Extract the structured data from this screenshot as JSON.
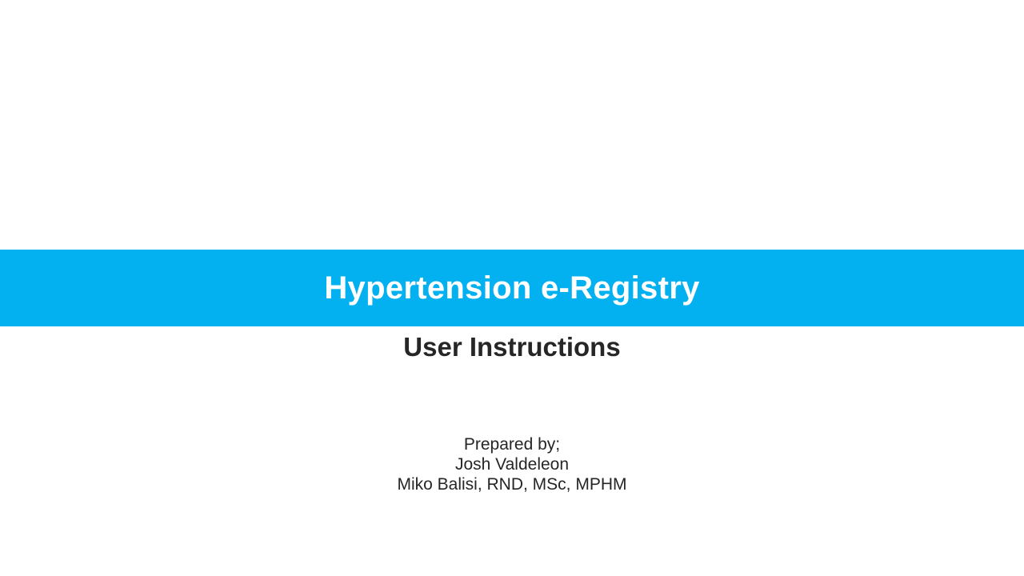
{
  "slide": {
    "title": "Hypertension e-Registry",
    "subtitle": "User Instructions",
    "prepared_by_label": "Prepared by;",
    "authors": [
      "Josh Valdeleon",
      "Miko Balisi, RND, MSc, MPHM"
    ]
  },
  "colors": {
    "title_band": "#03b0f0",
    "title_text": "#ffffff",
    "body_text": "#262626",
    "background": "#ffffff"
  }
}
